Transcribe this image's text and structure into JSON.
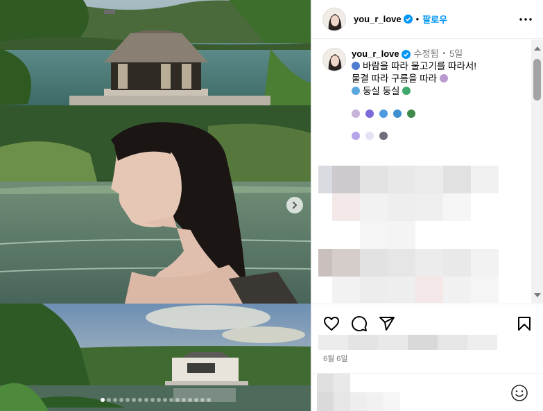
{
  "post": {
    "username": "you_r_love",
    "follow_label": "팔로우",
    "separator": "•",
    "caption": {
      "edited_label": "수정됨",
      "age": "5일",
      "line1": "바람을 따라 물고기를 따라서!",
      "line2": "물결 따라 구름을 따라",
      "line3": "둥실 둥실"
    },
    "date_label": "6월 6일"
  },
  "carousel": {
    "total_slides": 18,
    "active_index": 0
  },
  "colors": {
    "accent": "#0095f6",
    "verified": "#0095f6",
    "muted": "#737373"
  },
  "icons": [
    "more-options-icon",
    "verified-badge-icon",
    "like-heart-icon",
    "comment-icon",
    "share-icon",
    "save-bookmark-icon",
    "emoji-smile-icon",
    "chevron-right-icon"
  ]
}
